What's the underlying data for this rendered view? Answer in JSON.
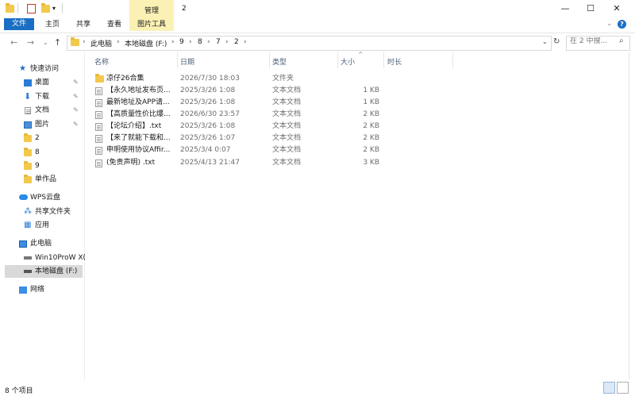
{
  "window": {
    "title": "2",
    "contextual_group": "管理",
    "controls": {
      "minimize": "—",
      "maximize": "☐",
      "close": "✕"
    }
  },
  "ribbon": {
    "tabs": [
      "文件",
      "主页",
      "共享",
      "查看",
      "图片工具"
    ],
    "active_color": "#1a6fc4",
    "contextual_color": "#fbf1b5",
    "help": "?"
  },
  "address": {
    "crumbs": [
      "此电脑",
      "本地磁盘 (F:)",
      "9",
      "8",
      "7",
      "2"
    ],
    "search_placeholder": "在 2 中搜..."
  },
  "nav": {
    "quick_access": "快速访问",
    "items": [
      {
        "label": "桌面",
        "icon": "desktop-icon",
        "pinned": true
      },
      {
        "label": "下载",
        "icon": "download-icon",
        "pinned": true
      },
      {
        "label": "文档",
        "icon": "document-icon",
        "pinned": true
      },
      {
        "label": "图片",
        "icon": "picture-icon",
        "pinned": true
      },
      {
        "label": "2",
        "icon": "folder-icon",
        "pinned": false
      },
      {
        "label": "8",
        "icon": "folder-icon",
        "pinned": false
      },
      {
        "label": "9",
        "icon": "folder-icon",
        "pinned": false
      },
      {
        "label": "单作品",
        "icon": "folder-icon",
        "pinned": false
      }
    ],
    "wps": "WPS云盘",
    "wps_items": [
      "共享文件夹",
      "应用"
    ],
    "this_pc": "此电脑",
    "drives": [
      "Win10ProW X(",
      "本地磁盘 (F:)"
    ],
    "network": "网络"
  },
  "list": {
    "headers": {
      "name": "名称",
      "date": "日期",
      "type": "类型",
      "size": "大小",
      "duration": "时长"
    },
    "rows": [
      {
        "name": "凉仔26合集",
        "date": "2026/7/30 18:03",
        "type": "文件夹",
        "size": "",
        "icon": "folder-icon"
      },
      {
        "name": "【永久地址发布页...",
        "date": "2025/3/26 1:08",
        "type": "文本文档",
        "size": "1 KB",
        "icon": "text-file-icon"
      },
      {
        "name": "最新地址及APP请...",
        "date": "2025/3/26 1:08",
        "type": "文本文档",
        "size": "1 KB",
        "icon": "text-file-icon"
      },
      {
        "name": "【高质量性价比爆...",
        "date": "2026/6/30 23:57",
        "type": "文本文档",
        "size": "2 KB",
        "icon": "text-file-icon"
      },
      {
        "name": "【论坛介绍】.txt",
        "date": "2025/3/26 1:08",
        "type": "文本文档",
        "size": "2 KB",
        "icon": "text-file-icon"
      },
      {
        "name": "【来了就能下载和...",
        "date": "2025/3/26 1:07",
        "type": "文本文档",
        "size": "2 KB",
        "icon": "text-file-icon"
      },
      {
        "name": "申明使用协议Affir...",
        "date": "2025/3/4 0:07",
        "type": "文本文档",
        "size": "2 KB",
        "icon": "text-file-icon"
      },
      {
        "name": "(免责声明) .txt",
        "date": "2025/4/13 21:47",
        "type": "文本文档",
        "size": "3 KB",
        "icon": "text-file-icon"
      }
    ]
  },
  "status": {
    "item_count": "8 个项目"
  }
}
